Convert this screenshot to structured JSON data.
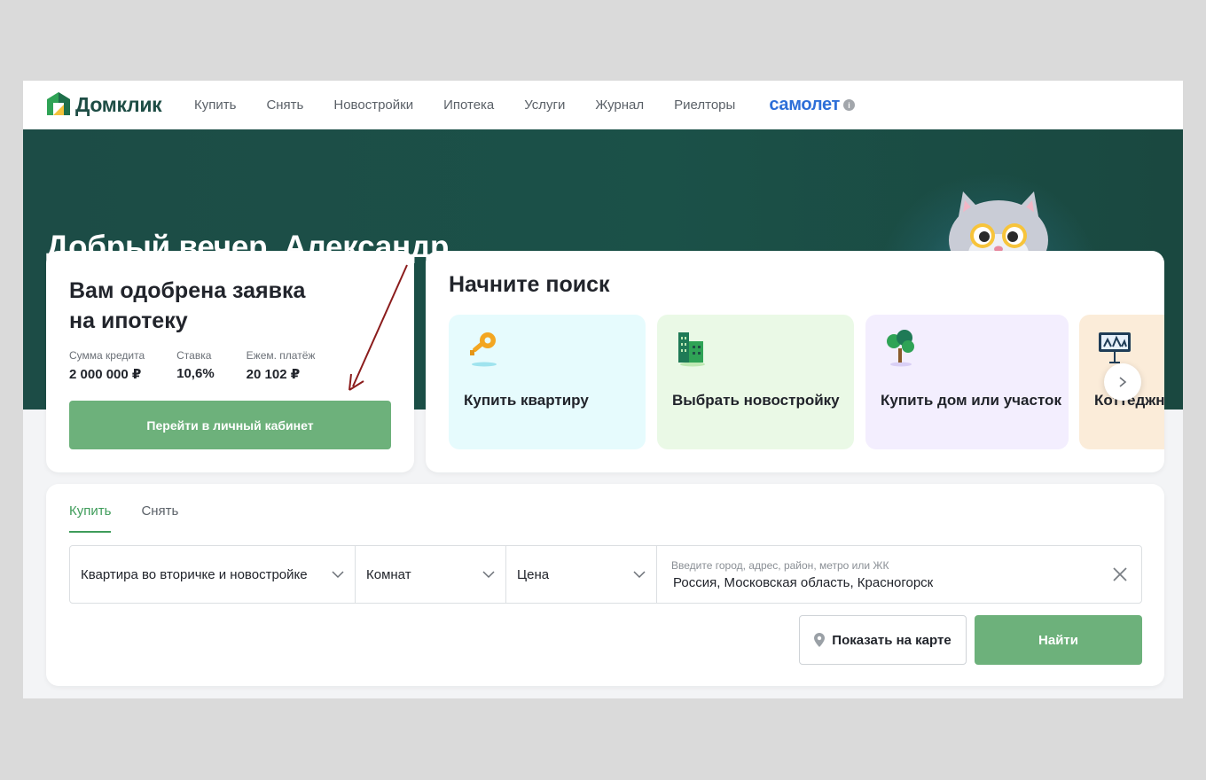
{
  "header": {
    "logo_text": "Домклик",
    "nav": [
      "Купить",
      "Снять",
      "Новостройки",
      "Ипотека",
      "Услуги",
      "Журнал",
      "Риелторы"
    ],
    "partner": "самолет",
    "partner_info_icon": "i"
  },
  "hero": {
    "greeting": "Добрый вечер, Александр"
  },
  "approval": {
    "title": "Вам одобрена заявка на ипотеку",
    "stats": [
      {
        "label": "Сумма кредита",
        "value": "2 000 000 ₽"
      },
      {
        "label": "Ставка",
        "value": "10,6%"
      },
      {
        "label": "Ежем. платёж",
        "value": "20 102 ₽"
      }
    ],
    "button": "Перейти в личный кабинет"
  },
  "start_search": {
    "title": "Начните поиск",
    "tiles": [
      {
        "label": "Купить квартиру",
        "icon": "key-icon"
      },
      {
        "label": "Выбрать новостройку",
        "icon": "building-icon"
      },
      {
        "label": "Купить дом или участок",
        "icon": "tree-icon"
      },
      {
        "label": "Коттеджн",
        "icon": "billboard-icon"
      }
    ],
    "next_icon": "›"
  },
  "search": {
    "tabs": [
      "Купить",
      "Снять"
    ],
    "active_tab": "Купить",
    "property_type": "Квартира во вторичке и новостройке",
    "rooms": "Комнат",
    "price": "Цена",
    "location_placeholder": "Введите город, адрес, район, метро или ЖК",
    "location_value": "Россия, Московская область, Красногорск",
    "map_button": "Показать на карте",
    "find_button": "Найти"
  },
  "colors": {
    "brand_green": "#6db17b",
    "hero_bg": "#1b5148",
    "partner_blue": "#2e6fd8",
    "annotation_arrow": "#8b1c1c"
  }
}
